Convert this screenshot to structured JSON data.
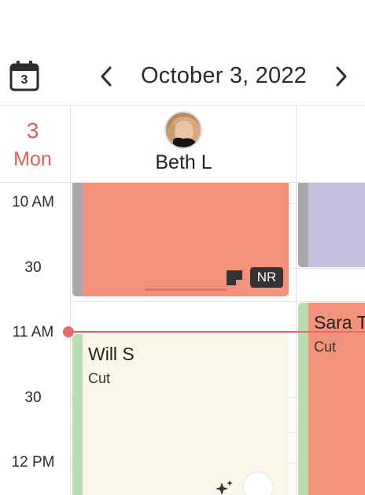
{
  "header": {
    "calendar_day": "3",
    "date_title": "October 3, 2022"
  },
  "day_column": {
    "day_number": "3",
    "day_name": "Mon"
  },
  "staff": [
    {
      "name": "Beth L"
    }
  ],
  "time_labels": [
    "10 AM",
    "30",
    "11 AM",
    "30",
    "12 PM"
  ],
  "appointments": [
    {
      "client": "",
      "service": "",
      "color": "#f3937b",
      "stripe": "#a9a9a9",
      "badge": "NR"
    },
    {
      "client": "",
      "service": "",
      "color": "#c6c0de",
      "stripe": "#a9a9a9"
    },
    {
      "client": "Will S",
      "service": "Cut",
      "color": "#fbf7e8",
      "stripe": "#b9dcb1"
    },
    {
      "client": "Sara T",
      "service": "Cut",
      "color": "#f3937b",
      "stripe": "#b9dcb1"
    }
  ],
  "colors": {
    "accent": "#e35d5b",
    "now_line": "#e66a6a"
  }
}
